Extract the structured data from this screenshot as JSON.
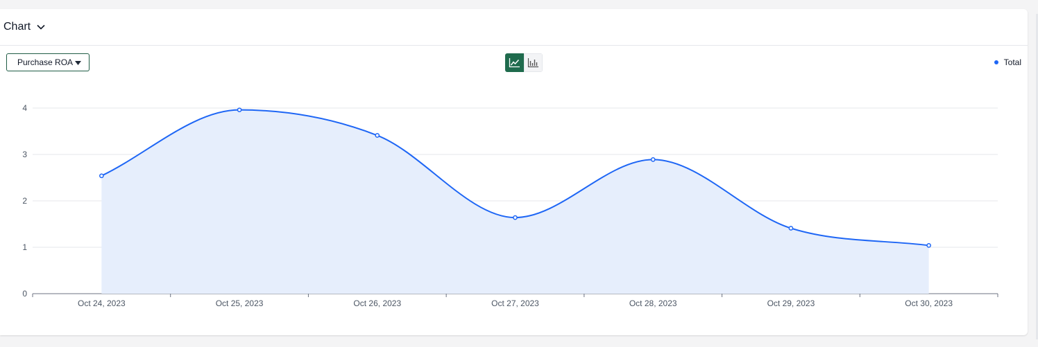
{
  "header": {
    "title": "Chart"
  },
  "controls": {
    "metric_label": "Purchase ROA",
    "chart_types": [
      "line",
      "bar"
    ],
    "active_chart_type": "line"
  },
  "colors": {
    "series": "#1e66f5",
    "area": "#e6eefc",
    "accent": "#1f6b4d"
  },
  "chart_data": {
    "type": "area",
    "x": [
      "Oct 24, 2023",
      "Oct 25, 2023",
      "Oct 26, 2023",
      "Oct 27, 2023",
      "Oct 28, 2023",
      "Oct 29, 2023",
      "Oct 30, 2023"
    ],
    "series": [
      {
        "name": "Total",
        "values": [
          2.54,
          3.96,
          3.41,
          1.64,
          2.89,
          1.41,
          1.04
        ]
      }
    ],
    "yticks": [
      "0",
      "1",
      "2",
      "3",
      "4"
    ],
    "ylim": [
      0,
      4
    ],
    "grid": true,
    "legend_position": "top-right",
    "smooth": true
  }
}
